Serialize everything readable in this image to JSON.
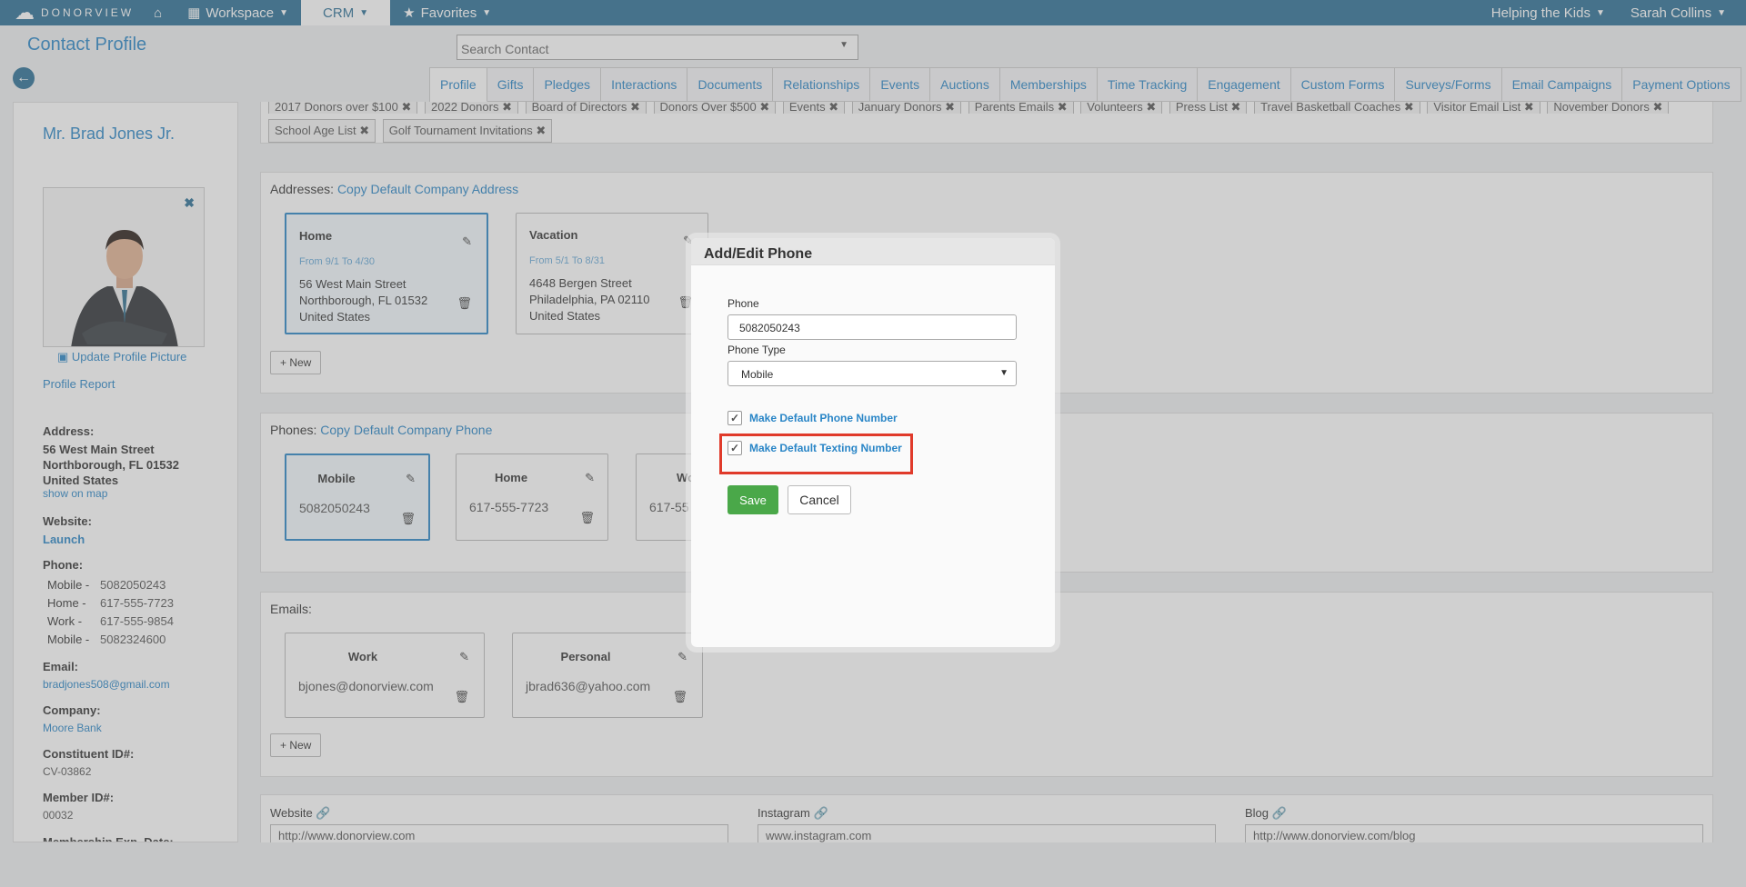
{
  "nav": {
    "logo": "DONORVIEW",
    "workspace": "Workspace",
    "crm": "CRM",
    "favorites": "Favorites",
    "org": "Helping the Kids",
    "user": "Sarah Collins"
  },
  "header": {
    "title": "Contact Profile",
    "search_placeholder": "Search Contact"
  },
  "tabs": [
    "Profile",
    "Gifts",
    "Pledges",
    "Interactions",
    "Documents",
    "Relationships",
    "Events",
    "Auctions",
    "Memberships",
    "Time Tracking",
    "Engagement",
    "Custom Forms",
    "Surveys/Forms",
    "Email Campaigns",
    "Payment Options"
  ],
  "sidebar": {
    "name": "Mr. Brad Jones Jr.",
    "update_picture": "Update Profile Picture",
    "profile_report": "Profile Report",
    "address_label": "Address:",
    "address_line1": "56 West Main Street",
    "address_line2": "Northborough, FL 01532",
    "address_line3": "United States",
    "show_on_map": "show on map",
    "website_label": "Website:",
    "website_link": "Launch",
    "phone_label": "Phone:",
    "phones": [
      {
        "type": "Mobile -",
        "number": "5082050243"
      },
      {
        "type": "Home -",
        "number": "617-555-7723"
      },
      {
        "type": "Work -",
        "number": "617-555-9854"
      },
      {
        "type": "Mobile -",
        "number": "5082324600"
      }
    ],
    "email_label": "Email:",
    "email": "bradjones508@gmail.com",
    "company_label": "Company:",
    "company": "Moore Bank",
    "constituent_label": "Constituent ID#:",
    "constituent_id": "CV-03862",
    "member_label": "Member ID#:",
    "member_id": "00032",
    "membership_exp_label": "Membership Exp. Date:"
  },
  "tags": {
    "row1": [
      "2017 Donors over $100",
      "2022 Donors",
      "Board of Directors",
      "Donors Over $500",
      "Events",
      "January Donors",
      "Parents Emails",
      "Volunteers",
      "Press List",
      "Travel Basketball Coaches",
      "Visitor Email List",
      "November Donors"
    ],
    "row2": [
      "School Age List",
      "Golf Tournament Invitations"
    ]
  },
  "addresses": {
    "label": "Addresses:",
    "copy_link": "Copy Default Company Address",
    "cards": [
      {
        "title": "Home",
        "dates": "From 9/1 To 4/30",
        "line1": "56 West Main Street",
        "line2": "Northborough, FL 01532",
        "line3": "United States"
      },
      {
        "title": "Vacation",
        "dates": "From 5/1 To 8/31",
        "line1": "4648 Bergen Street",
        "line2": "Philadelphia, PA 02110",
        "line3": "United States"
      }
    ],
    "new_label": "New"
  },
  "phones": {
    "label": "Phones:",
    "copy_link": "Copy Default Company Phone",
    "cards": [
      {
        "title": "Mobile",
        "number": "5082050243"
      },
      {
        "title": "Home",
        "number": "617-555-7723"
      },
      {
        "title": "Wo",
        "number": "617-55"
      }
    ]
  },
  "emails": {
    "label": "Emails:",
    "cards": [
      {
        "title": "Work",
        "address": "bjones@donorview.com"
      },
      {
        "title": "Personal",
        "address": "jbrad636@yahoo.com"
      }
    ],
    "new_label": "New"
  },
  "social": [
    {
      "label": "Website",
      "value": "http://www.donorview.com"
    },
    {
      "label": "Instagram",
      "value": "www.instagram.com"
    },
    {
      "label": "Blog",
      "value": "http://www.donorview.com/blog"
    }
  ],
  "modal": {
    "title": "Add/Edit Phone",
    "phone_label": "Phone",
    "phone_value": "5082050243",
    "type_label": "Phone Type",
    "type_value": "Mobile",
    "default_phone": "Make Default Phone Number",
    "default_phone_checked": true,
    "default_texting": "Make Default Texting Number",
    "default_texting_checked": true,
    "save": "Save",
    "cancel": "Cancel"
  },
  "colors": {
    "nav": "#2b6f95",
    "link": "#2a86c7",
    "save": "#4aa849",
    "highlight": "#e03a2a"
  }
}
